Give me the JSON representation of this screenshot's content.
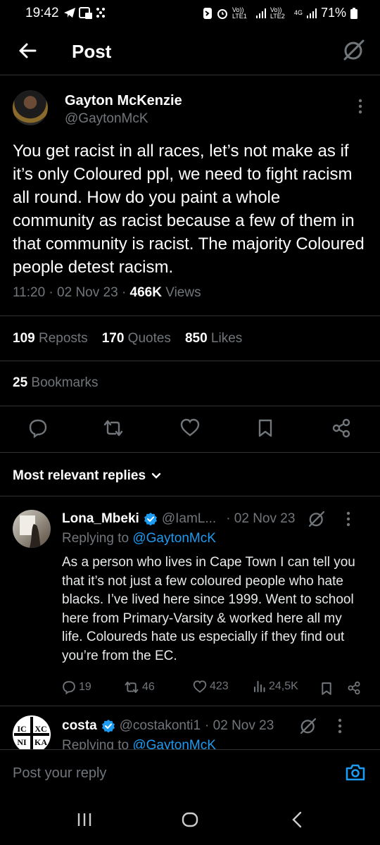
{
  "status_bar": {
    "time": "19:42",
    "battery": "71%",
    "net1": "Vo)) LTE1",
    "net2": "Vo)) LTE2",
    "net3": "4G"
  },
  "header": {
    "title": "Post"
  },
  "tweet": {
    "author_name": "Gayton McKenzie",
    "author_handle": "@GaytonMcK",
    "text": "You get racist in all races, let’s not make as if it’s only Coloured ppl, we need to fight racism all round. How do you paint a whole community as racist because a few of them in that community is racist. The majority Coloured people detest racism.",
    "time": "11:20",
    "date": "02 Nov 23",
    "views_count": "466K",
    "views_label": "Views",
    "sep": "·",
    "reposts_count": "109",
    "reposts_label": "Reposts",
    "quotes_count": "170",
    "quotes_label": "Quotes",
    "likes_count": "850",
    "likes_label": "Likes",
    "bookmarks_count": "25",
    "bookmarks_label": "Bookmarks"
  },
  "replies_sort": {
    "label": "Most relevant replies"
  },
  "replies": [
    {
      "name": "Lona_Mbeki",
      "handle": "@IamL...",
      "date": "· 02 Nov 23",
      "replying_prefix": "Replying to",
      "replying_to": "@GaytonMcK",
      "text": "As a person who lives in Cape Town I can tell you that it’s not just a few coloured people who hate blacks. I’ve lived here since 1999. Went to school here from Primary-Varsity & worked here all my life. Coloureds hate us especially if they find out you’re from the EC.",
      "replies": "19",
      "reposts": "46",
      "likes": "423",
      "views": "24,5K"
    },
    {
      "name": "costa",
      "handle": "@costakonti1",
      "date": "· 02 Nov 23",
      "replying_prefix": "Replying to",
      "replying_to": "@GaytonMcK",
      "avatar_text": [
        "IC",
        "XC",
        "NI",
        "KA"
      ]
    }
  ],
  "compose": {
    "placeholder": "Post your reply"
  },
  "colors": {
    "accent": "#1d9bf0",
    "background": "#000000",
    "muted": "#71767b",
    "text": "#e7e9ea",
    "divider": "#2f3336"
  }
}
